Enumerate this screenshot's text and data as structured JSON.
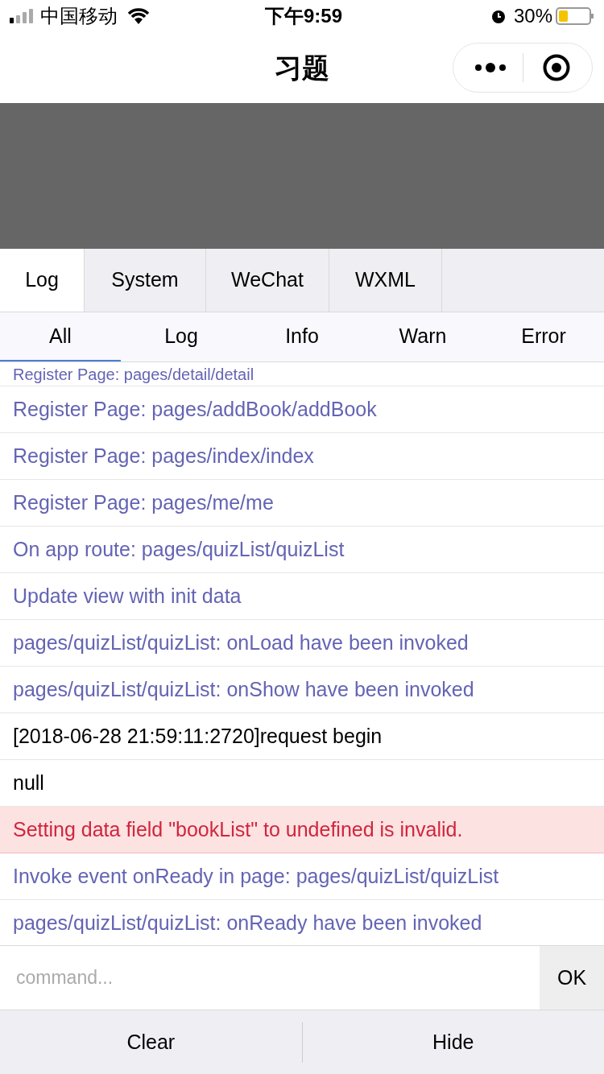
{
  "status_bar": {
    "carrier": "中国移动",
    "time": "下午9:59",
    "battery": "30%"
  },
  "nav": {
    "title": "习题"
  },
  "tabs": [
    {
      "label": "Log",
      "selected": true
    },
    {
      "label": "System",
      "selected": false
    },
    {
      "label": "WeChat",
      "selected": false
    },
    {
      "label": "WXML",
      "selected": false
    }
  ],
  "filters": [
    {
      "label": "All",
      "selected": true
    },
    {
      "label": "Log",
      "selected": false
    },
    {
      "label": "Info",
      "selected": false
    },
    {
      "label": "Warn",
      "selected": false
    },
    {
      "label": "Error",
      "selected": false
    }
  ],
  "logs": [
    {
      "kind": "info",
      "text": "Register Page: pages/detail/detail"
    },
    {
      "kind": "info",
      "text": "Register Page: pages/addBook/addBook"
    },
    {
      "kind": "info",
      "text": "Register Page: pages/index/index"
    },
    {
      "kind": "info",
      "text": "Register Page: pages/me/me"
    },
    {
      "kind": "info",
      "text": "On app route: pages/quizList/quizList"
    },
    {
      "kind": "info",
      "text": "Update view with init data"
    },
    {
      "kind": "info",
      "text": "pages/quizList/quizList: onLoad have been invoked"
    },
    {
      "kind": "info",
      "text": "pages/quizList/quizList: onShow have been invoked"
    },
    {
      "kind": "log",
      "text": "[2018-06-28 21:59:11:2720]request begin"
    },
    {
      "kind": "log",
      "text": "null"
    },
    {
      "kind": "error",
      "text": "Setting data field \"bookList\" to undefined is invalid."
    },
    {
      "kind": "info",
      "text": "Invoke event onReady in page: pages/quizList/quizList"
    },
    {
      "kind": "info",
      "text": "pages/quizList/quizList: onReady have been invoked"
    }
  ],
  "command": {
    "placeholder": "command...",
    "button": "OK"
  },
  "actions": [
    "Clear",
    "Hide"
  ]
}
